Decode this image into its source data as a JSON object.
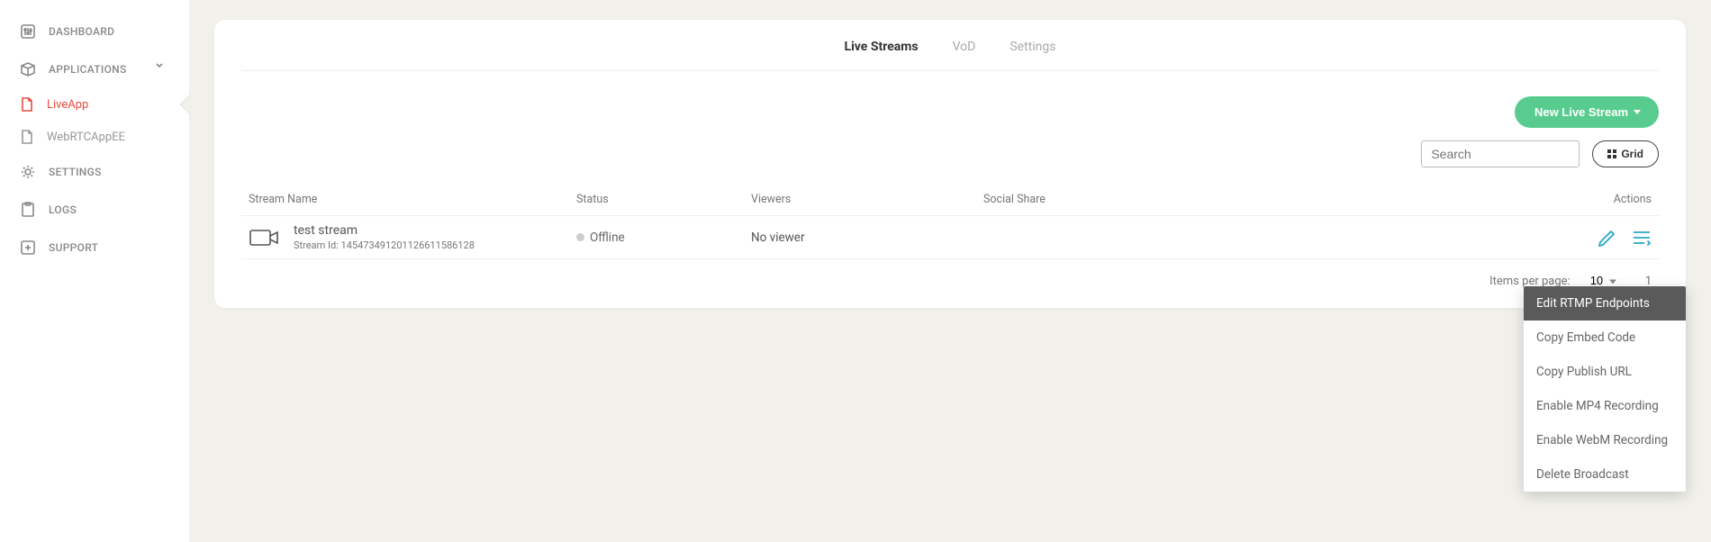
{
  "sidebar": {
    "items": [
      {
        "label": "DASHBOARD"
      },
      {
        "label": "APPLICATIONS"
      },
      {
        "label": "SETTINGS"
      },
      {
        "label": "LOGS"
      },
      {
        "label": "SUPPORT"
      }
    ],
    "apps": [
      {
        "label": "LiveApp"
      },
      {
        "label": "WebRTCAppEE"
      }
    ]
  },
  "tabs": [
    {
      "label": "Live Streams"
    },
    {
      "label": "VoD"
    },
    {
      "label": "Settings"
    }
  ],
  "new_button": "New Live Stream",
  "search": {
    "placeholder": "Search"
  },
  "grid_button": "Grid",
  "table": {
    "headers": {
      "name": "Stream Name",
      "status": "Status",
      "viewers": "Viewers",
      "social": "Social Share",
      "actions": "Actions"
    },
    "rows": [
      {
        "name": "test stream",
        "id_label": "Stream Id: 145473491201126611586128",
        "status": "Offline",
        "viewers": "No viewer"
      }
    ]
  },
  "pagination": {
    "items_label": "Items per page:",
    "items_value": "10",
    "range": "1"
  },
  "dropdown": {
    "items": [
      "Edit RTMP Endpoints",
      "Copy Embed Code",
      "Copy Publish URL",
      "Enable MP4 Recording",
      "Enable WebM Recording",
      "Delete Broadcast"
    ]
  }
}
